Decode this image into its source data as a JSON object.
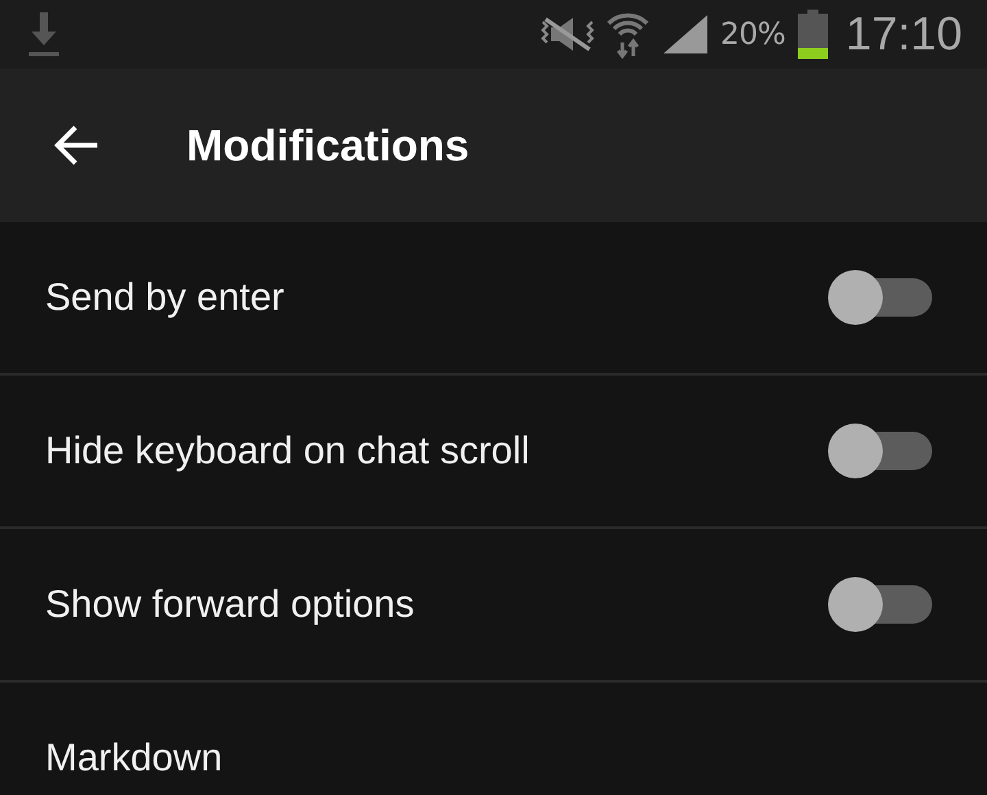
{
  "status_bar": {
    "battery": "20%",
    "time": "17:10"
  },
  "app_bar": {
    "title": "Modifications"
  },
  "settings": [
    {
      "kind": "toggle",
      "label": "Send by enter",
      "on": false
    },
    {
      "kind": "toggle",
      "label": "Hide keyboard on chat scroll",
      "on": false
    },
    {
      "kind": "toggle",
      "label": "Show forward options",
      "on": false
    },
    {
      "kind": "plain",
      "label": "Markdown"
    }
  ]
}
